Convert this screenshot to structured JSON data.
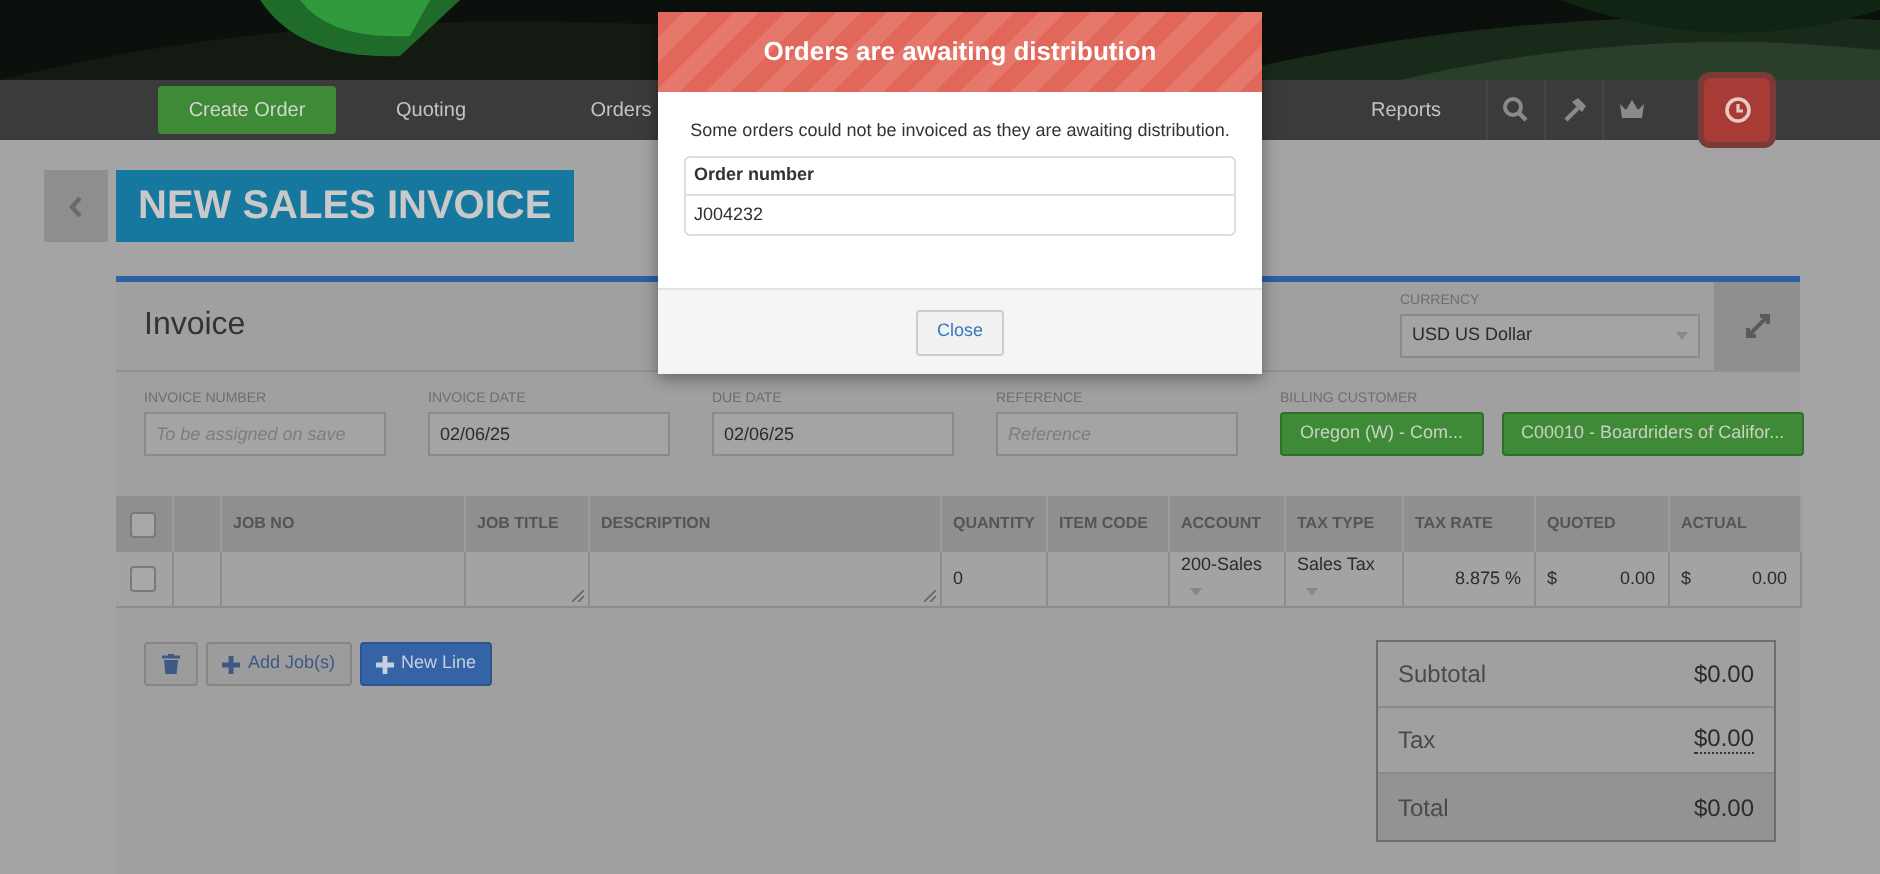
{
  "nav": {
    "items": [
      {
        "label": "Create Order",
        "kind": "button"
      },
      {
        "label": "Quoting",
        "kind": "link"
      },
      {
        "label": "Orders",
        "kind": "link"
      },
      {
        "label": "Reports",
        "kind": "link",
        "push": true
      }
    ],
    "icons": [
      {
        "active": false
      },
      {
        "active": false
      },
      {
        "active": false
      },
      {
        "active": true
      }
    ]
  },
  "page_title": "NEW SALES INVOICE",
  "invoice": {
    "title": "Invoice",
    "currency": {
      "label": "CURRENCY",
      "value": "USD US Dollar"
    },
    "fields": [
      {
        "label": "INVOICE NUMBER",
        "placeholder": "To be assigned on save"
      },
      {
        "label": "INVOICE DATE",
        "value": "02/06/25"
      },
      {
        "label": "DUE DATE",
        "value": "02/06/25"
      },
      {
        "label": "REFERENCE",
        "placeholder": "Reference"
      }
    ],
    "billing_customer": {
      "label": "BILLING CUSTOMER",
      "buttons": [
        "Oregon (W) - Com...",
        "C00010 - Boardriders of Califor..."
      ]
    },
    "table": {
      "header_checked": false,
      "columns": [
        "JOB NO",
        "JOB TITLE",
        "DESCRIPTION",
        "QUANTITY",
        "ITEM CODE",
        "ACCOUNT",
        "TAX TYPE",
        "TAX RATE",
        "QUOTED",
        "ACTUAL"
      ],
      "rows": [
        {
          "checked": false,
          "job_no": "",
          "quantity": "0",
          "account": "200-Sales",
          "tax_type": "Sales Tax",
          "tax_rate": "8.875 %",
          "quoted_currency": "$",
          "quoted": "0.00",
          "actual_currency": "$",
          "actual": "0.00"
        }
      ]
    },
    "actions": [
      {
        "kind": "trash"
      },
      {
        "kind": "plain",
        "label": "Add Job(s)"
      },
      {
        "kind": "primary",
        "label": "New Line"
      }
    ],
    "totals": [
      {
        "label": "Subtotal",
        "value": "$0.00",
        "underlined": false,
        "emphasis": false
      },
      {
        "label": "Tax",
        "value": "$0.00",
        "underlined": true,
        "emphasis": false
      },
      {
        "label": "Total",
        "value": "$0.00",
        "underlined": false,
        "emphasis": true
      }
    ]
  },
  "modal": {
    "title": "Orders are awaiting distribution",
    "message": "Some orders could not be invoiced as they are awaiting distribution.",
    "table": {
      "column": "Order number",
      "rows": [
        "J004232"
      ]
    },
    "button": "Close"
  }
}
